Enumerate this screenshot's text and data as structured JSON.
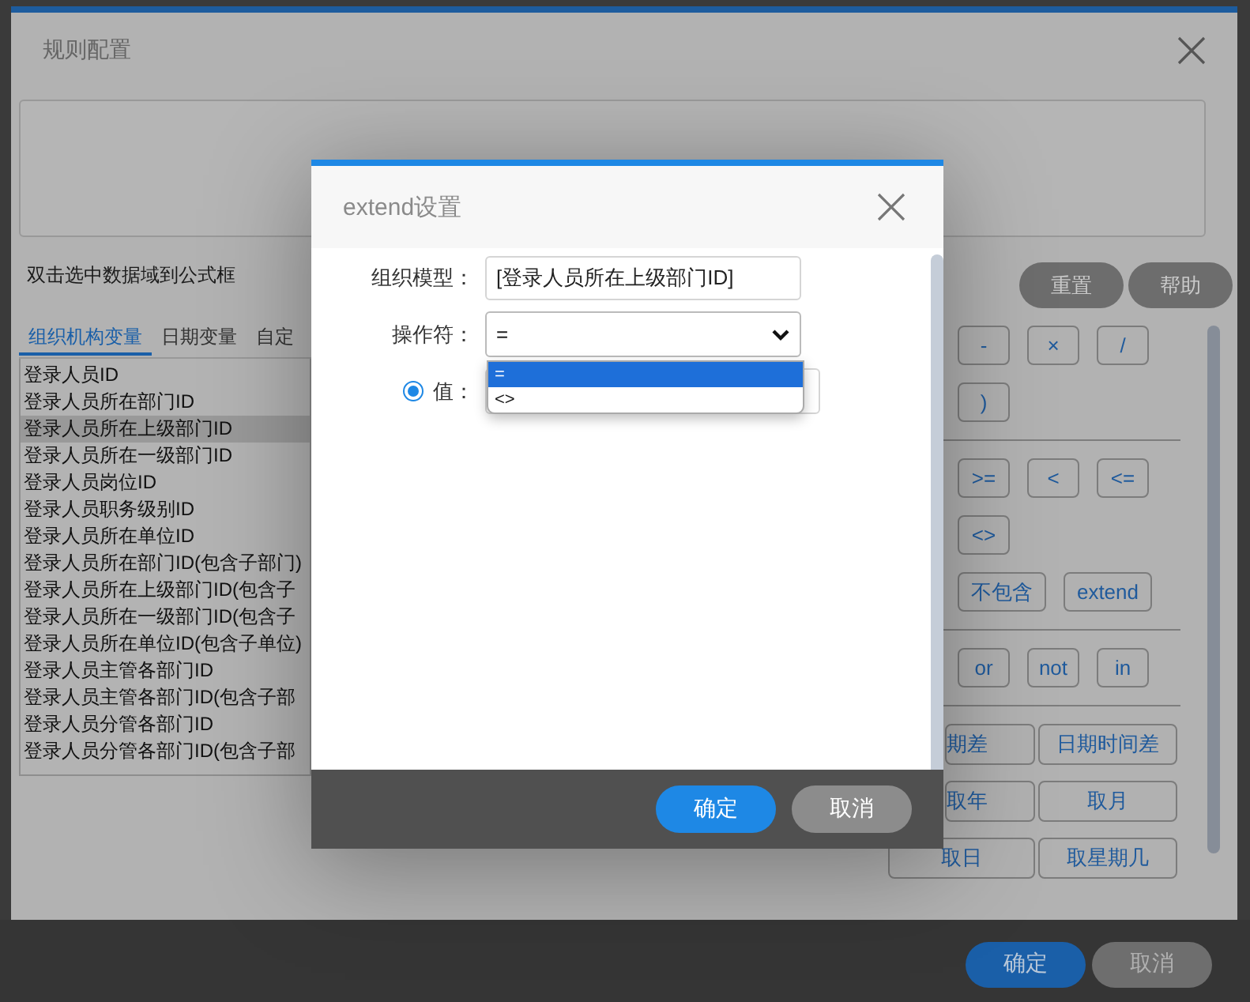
{
  "window": {
    "title": "规则配置"
  },
  "hint": "双击选中数据域到公式框",
  "toolbar_buttons": [
    "重置",
    "帮助"
  ],
  "tabs": [
    {
      "label": "组织机构变量",
      "selected": true
    },
    {
      "label": "日期变量",
      "selected": false
    },
    {
      "label": "自定",
      "selected": false
    }
  ],
  "variables": [
    {
      "label": "登录人员ID",
      "selected": false
    },
    {
      "label": "登录人员所在部门ID",
      "selected": false
    },
    {
      "label": "登录人员所在上级部门ID",
      "selected": true
    },
    {
      "label": "登录人员所在一级部门ID",
      "selected": false
    },
    {
      "label": "登录人员岗位ID",
      "selected": false
    },
    {
      "label": "登录人员职务级别ID",
      "selected": false
    },
    {
      "label": "登录人员所在单位ID",
      "selected": false
    },
    {
      "label": "登录人员所在部门ID(包含子部门)",
      "selected": false
    },
    {
      "label": "登录人员所在上级部门ID(包含子",
      "selected": false
    },
    {
      "label": "登录人员所在一级部门ID(包含子",
      "selected": false
    },
    {
      "label": "登录人员所在单位ID(包含子单位)",
      "selected": false
    },
    {
      "label": "登录人员主管各部门ID",
      "selected": false
    },
    {
      "label": "登录人员主管各部门ID(包含子部",
      "selected": false
    },
    {
      "label": "登录人员分管各部门ID",
      "selected": false
    },
    {
      "label": "登录人员分管各部门ID(包含子部",
      "selected": false
    }
  ],
  "operator_groups": [
    [
      [
        "-",
        "×",
        "/"
      ],
      [
        ")"
      ]
    ],
    [
      [
        ">=",
        "<",
        "<="
      ],
      [
        "<>"
      ],
      [
        "不包含",
        "extend"
      ]
    ],
    [
      [
        "or",
        "not",
        "in"
      ]
    ]
  ],
  "function_rows": [
    [
      "期差",
      "日期时间差"
    ],
    [
      "取年",
      "取月"
    ],
    [
      "取日",
      "取星期几"
    ]
  ],
  "footer_buttons": [
    {
      "label": "确定",
      "kind": "primary"
    },
    {
      "label": "取消",
      "kind": "secondary"
    }
  ],
  "extend_dialog": {
    "title": "extend设置",
    "fields": [
      {
        "label": "组织模型：",
        "value": "[登录人员所在上级部门ID]"
      }
    ],
    "operator": {
      "label": "操作符：",
      "value": "=",
      "expanded": true,
      "options": [
        {
          "label": "=",
          "selected": true
        },
        {
          "label": "<>",
          "selected": false
        }
      ]
    },
    "value_option": {
      "label": "值：",
      "selected": true
    },
    "buttons": [
      {
        "label": "确定",
        "kind": "primary"
      },
      {
        "label": "取消",
        "kind": "secondary"
      }
    ]
  }
}
